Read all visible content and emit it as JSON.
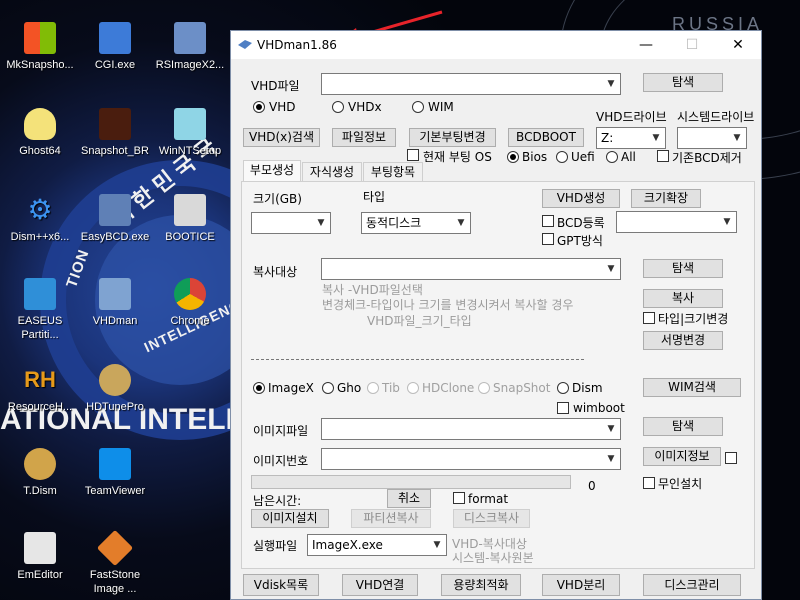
{
  "desktop": {
    "icons": [
      {
        "label": "MkSnapsho...",
        "icon": "windows-logo-icon"
      },
      {
        "label": "CGI.exe",
        "icon": "cgi-app-icon"
      },
      {
        "label": "RSImageX2...",
        "icon": "rsimagex-icon"
      },
      {
        "label": "Ghost64",
        "icon": "ghost-icon"
      },
      {
        "label": "Snapshot_BR",
        "icon": "snapshot-br-icon"
      },
      {
        "label": "WinNTSetup",
        "icon": "winntsetup-icon"
      },
      {
        "label": "Dism++x6...",
        "icon": "gear-icon"
      },
      {
        "label": "EasyBCD.exe",
        "icon": "easybcd-icon"
      },
      {
        "label": "BOOTICE",
        "icon": "bootice-icon"
      },
      {
        "label": "EASEUS Partiti...",
        "icon": "easeus-icon"
      },
      {
        "label": "VHDman",
        "icon": "vhdman-icon"
      },
      {
        "label": "Chrome",
        "icon": "chrome-icon"
      },
      {
        "label": "ResourceH...",
        "icon": "resource-hacker-icon"
      },
      {
        "label": "HDTunePro",
        "icon": "hdtune-icon"
      },
      {
        "label": "T.Dism",
        "icon": "tdism-icon"
      },
      {
        "label": "TeamViewer",
        "icon": "teamviewer-icon"
      },
      {
        "label": "EmEditor",
        "icon": "emeditor-icon"
      },
      {
        "label": "FastStone Image ...",
        "icon": "faststone-icon"
      }
    ],
    "wallpaper": {
      "korea_text": "대 한 민 국 국",
      "tion_text": "TION",
      "intelligence_text": "INTELLIGENC",
      "banner": "ATIONAL INTELLIC",
      "russia": "RUSSIA"
    }
  },
  "window": {
    "title": "VHDman1.86",
    "minimize": "—",
    "maximize": "☐",
    "close": "✕",
    "vhd_file_label": "VHD파일",
    "vhd_file_value": "",
    "browse_label": "탐색",
    "vhd_type_options": [
      "VHD",
      "VHDx",
      "WIM"
    ],
    "vhd_type_selected": "VHD",
    "vhd_drive_label": "VHD드라이브",
    "system_drive_label": "시스템드라이브",
    "vhd_drive_value": "Z:",
    "system_drive_value": "",
    "btn_vhd_search": "VHD(x)검색",
    "btn_file_info": "파일정보",
    "btn_default_boot": "기본부팅변경",
    "btn_bcdboot": "BCDBOOT",
    "current_boot_os": "현재 부팅 OS",
    "boot_mode_options": [
      "Bios",
      "Uefi",
      "All"
    ],
    "boot_mode_selected": "Bios",
    "delete_existing_bcd": "기존BCD제거",
    "tabs": [
      "부모생성",
      "자식생성",
      "부팅항목"
    ],
    "active_tab": "부모생성",
    "size_label": "크기(GB)",
    "type_label": "타입",
    "type_value": "동적디스크",
    "size_value": "",
    "btn_vhd_create": "VHD생성",
    "btn_size_expand": "크기확장",
    "bcd_register": "BCD등록",
    "gpt_mode": "GPT방식",
    "copy_target_label": "복사대상",
    "copy_help": [
      "복사      -VHD파일선택",
      "변경체크-타입이나 크기를 변경시켜서 복사할 경우",
      "VHD파일_크기_타입"
    ],
    "btn_copy": "복사",
    "type_size_change": "타입|크기변경",
    "btn_signature_change": "서명변경",
    "image_tool_options": [
      "ImageX",
      "Gho",
      "Tib",
      "HDClone",
      "SnapShot",
      "Dism"
    ],
    "image_tool_selected": "ImageX",
    "btn_wim_search": "WIM검색",
    "wimboot": "wimboot",
    "image_file_label": "이미지파일",
    "image_number_label": "이미지번호",
    "btn_image_info": "이미지정보",
    "unattended_install": "무인설치",
    "remaining_time_label": "남은시간:",
    "btn_cancel": "취소",
    "format_label": "format",
    "progress_value": "0",
    "btn_image_install": "이미지설치",
    "btn_partition_copy": "파티션복사",
    "btn_disk_copy": "디스크복사",
    "exec_file_label": "실행파일",
    "exec_file_value": "ImageX.exe",
    "exec_help": [
      "VHD-복사대상",
      "시스템-복사원본"
    ],
    "bottom_buttons": [
      "Vdisk목록",
      "VHD연결",
      "용량최적화",
      "VHD분리",
      "디스크관리"
    ]
  },
  "colors": {
    "arrow": "#e8232a",
    "desktop_bg": "#0a1030",
    "seal_blue": "#1f3e91"
  }
}
